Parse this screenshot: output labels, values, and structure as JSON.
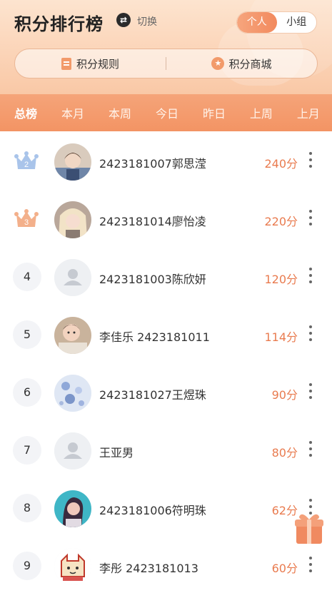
{
  "header": {
    "title": "积分排行榜",
    "switch_label": "切换",
    "segment": {
      "options": [
        "个人",
        "小组"
      ],
      "selected": "个人"
    },
    "rules_label": "积分规则",
    "shop_label": "积分商城"
  },
  "tabs": [
    "总榜",
    "本月",
    "本周",
    "今日",
    "昨日",
    "上周",
    "上月"
  ],
  "active_tab": "总榜",
  "rows": [
    {
      "rank": "2",
      "name": "2423181007郭思滢",
      "score": "240分",
      "badge": "silver-crown",
      "avatar": "photo-child"
    },
    {
      "rank": "3",
      "name": "2423181014廖怡凌",
      "score": "220分",
      "badge": "bronze-crown",
      "avatar": "photo-blonde"
    },
    {
      "rank": "4",
      "name": "2423181003陈欣妍",
      "score": "120分",
      "avatar": "default-person"
    },
    {
      "rank": "5",
      "name": "李佳乐 2423181011",
      "score": "114分",
      "avatar": "photo-baby"
    },
    {
      "rank": "6",
      "name": "2423181027王煜珠",
      "score": "90分",
      "avatar": "photo-pattern"
    },
    {
      "rank": "7",
      "name": "王亚男",
      "score": "80分",
      "avatar": "default-person"
    },
    {
      "rank": "8",
      "name": "2423181006符明珠",
      "score": "62分",
      "avatar": "photo-teal"
    },
    {
      "rank": "9",
      "name": "李彤 2423181013",
      "score": "60分",
      "avatar": "cartoon-cat"
    }
  ],
  "colors": {
    "accent": "#f39464",
    "score": "#e97b4f",
    "header_bg": "#fbd3b6"
  }
}
